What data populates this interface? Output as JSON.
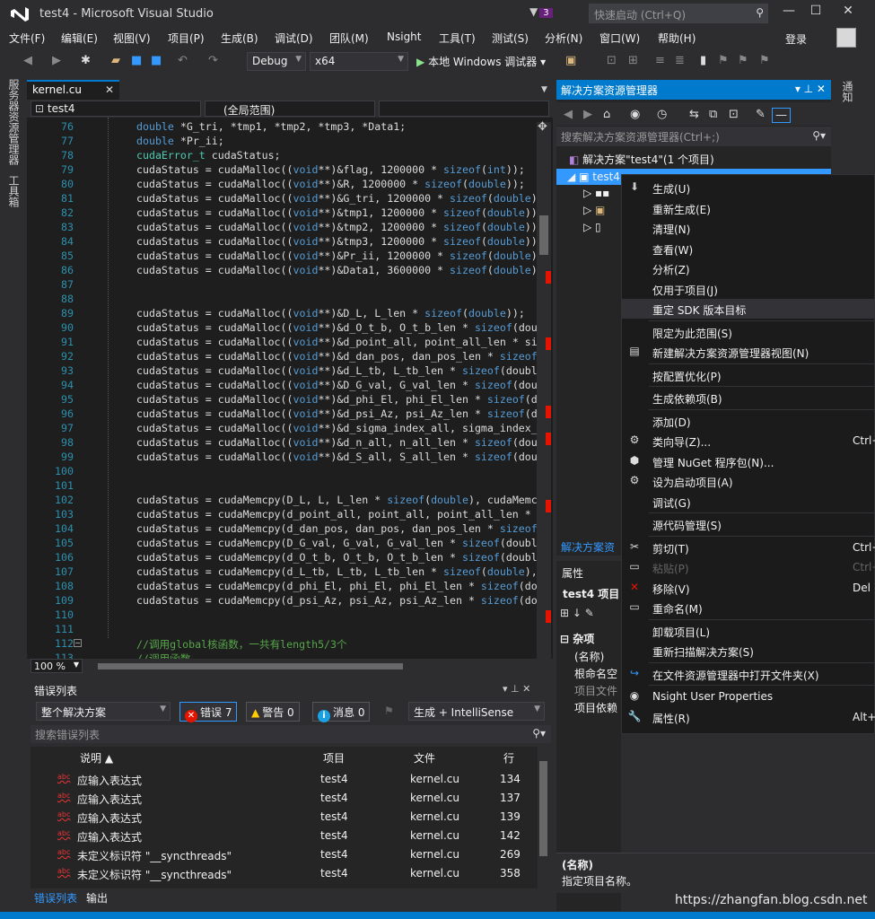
{
  "window": {
    "title": "test4 - Microsoft Visual Studio",
    "notification_count": "3",
    "quick_launch_placeholder": "快速启动 (Ctrl+Q)"
  },
  "menu": [
    "文件(F)",
    "编辑(E)",
    "视图(V)",
    "项目(P)",
    "生成(B)",
    "调试(D)",
    "团队(M)",
    "Nsight",
    "工具(T)",
    "测试(S)",
    "分析(N)",
    "窗口(W)",
    "帮助(H)"
  ],
  "login": "登录",
  "toolbar": {
    "config": "Debug",
    "platform": "x64",
    "run_label": "本地 Windows 调试器"
  },
  "left_tabs": [
    "服务器资源管理器",
    "工具箱"
  ],
  "editor": {
    "tab": "kernel.cu",
    "scope_project": "test4",
    "scope": "(全局范围)",
    "zoom": "100 %",
    "lines": [
      {
        "n": "76",
        "t": "double *G_tri, *tmp1, *tmp2, *tmp3, *Data1;"
      },
      {
        "n": "77",
        "t": "double *Pr_ii;"
      },
      {
        "n": "78",
        "t": "cudaError_t cudaStatus;"
      },
      {
        "n": "79",
        "t": "cudaStatus = cudaMalloc((void**)&flag, 1200000 * sizeof(int));"
      },
      {
        "n": "80",
        "t": "cudaStatus = cudaMalloc((void**)&R, 1200000 * sizeof(double));"
      },
      {
        "n": "81",
        "t": "cudaStatus = cudaMalloc((void**)&G_tri, 1200000 * sizeof(double));"
      },
      {
        "n": "82",
        "t": "cudaStatus = cudaMalloc((void**)&tmp1, 1200000 * sizeof(double));"
      },
      {
        "n": "83",
        "t": "cudaStatus = cudaMalloc((void**)&tmp2, 1200000 * sizeof(double));"
      },
      {
        "n": "84",
        "t": "cudaStatus = cudaMalloc((void**)&tmp3, 1200000 * sizeof(double));"
      },
      {
        "n": "85",
        "t": "cudaStatus = cudaMalloc((void**)&Pr_ii, 1200000 * sizeof(double));"
      },
      {
        "n": "86",
        "t": "cudaStatus = cudaMalloc((void**)&Data1, 3600000 * sizeof(double));"
      },
      {
        "n": "87",
        "t": ""
      },
      {
        "n": "88",
        "t": ""
      },
      {
        "n": "89",
        "t": "cudaStatus = cudaMalloc((void**)&D_L, L_len * sizeof(double));"
      },
      {
        "n": "90",
        "t": "cudaStatus = cudaMalloc((void**)&d_O_t_b, O_t_b_len * sizeof(dou"
      },
      {
        "n": "91",
        "t": "cudaStatus = cudaMalloc((void**)&d_point_all, point_all_len * si"
      },
      {
        "n": "92",
        "t": "cudaStatus = cudaMalloc((void**)&d_dan_pos, dan_pos_len * sizeof"
      },
      {
        "n": "93",
        "t": "cudaStatus = cudaMalloc((void**)&d_L_tb, L_tb_len * sizeof(doubl"
      },
      {
        "n": "94",
        "t": "cudaStatus = cudaMalloc((void**)&D_G_val, G_val_len * sizeof(dou"
      },
      {
        "n": "95",
        "t": "cudaStatus = cudaMalloc((void**)&d_phi_El, phi_El_len * sizeof(d"
      },
      {
        "n": "96",
        "t": "cudaStatus = cudaMalloc((void**)&d_psi_Az, psi_Az_len * sizeof(d"
      },
      {
        "n": "97",
        "t": "cudaStatus = cudaMalloc((void**)&d_sigma_index_all, sigma_index_"
      },
      {
        "n": "98",
        "t": "cudaStatus = cudaMalloc((void**)&d_n_all, n_all_len * sizeof(dou"
      },
      {
        "n": "99",
        "t": "cudaStatus = cudaMalloc((void**)&d_S_all, S_all_len * sizeof(dou"
      },
      {
        "n": "100",
        "t": ""
      },
      {
        "n": "101",
        "t": ""
      },
      {
        "n": "102",
        "t": "cudaStatus = cudaMemcpy(D_L, L, L_len * sizeof(double), cudaMemc"
      },
      {
        "n": "103",
        "t": "cudaStatus = cudaMemcpy(d_point_all, point_all, point_all_len *"
      },
      {
        "n": "104",
        "t": "cudaStatus = cudaMemcpy(d_dan_pos, dan_pos, dan_pos_len * sizeof"
      },
      {
        "n": "105",
        "t": "cudaStatus = cudaMemcpy(D_G_val, G_val, G_val_len * sizeof(doubl"
      },
      {
        "n": "106",
        "t": "cudaStatus = cudaMemcpy(d_O_t_b, O_t_b, O_t_b_len * sizeof(doubl"
      },
      {
        "n": "107",
        "t": "cudaStatus = cudaMemcpy(d_L_tb, L_tb, L_tb_len * sizeof(double),"
      },
      {
        "n": "108",
        "t": "cudaStatus = cudaMemcpy(d_phi_El, phi_El, phi_El_len * sizeof(do"
      },
      {
        "n": "109",
        "t": "cudaStatus = cudaMemcpy(d_psi_Az, psi_Az, psi_Az_len * sizeof(do"
      },
      {
        "n": "110",
        "t": ""
      },
      {
        "n": "111",
        "t": ""
      },
      {
        "n": "112",
        "t": "//调用global核函数，一共有length5/3个"
      },
      {
        "n": "113",
        "t": "//调用函数"
      }
    ]
  },
  "error_list": {
    "title": "错误列表",
    "scope": "整个解决方案",
    "errors_label": "错误 7",
    "warnings_label": "警告 0",
    "messages_label": "消息 0",
    "build_filter": "生成 + IntelliSense",
    "search_placeholder": "搜索错误列表",
    "columns": [
      "说明",
      "项目",
      "文件",
      "行"
    ],
    "rows": [
      {
        "desc": "应输入表达式",
        "project": "test4",
        "file": "kernel.cu",
        "line": "134"
      },
      {
        "desc": "应输入表达式",
        "project": "test4",
        "file": "kernel.cu",
        "line": "137"
      },
      {
        "desc": "应输入表达式",
        "project": "test4",
        "file": "kernel.cu",
        "line": "139"
      },
      {
        "desc": "应输入表达式",
        "project": "test4",
        "file": "kernel.cu",
        "line": "142"
      },
      {
        "desc": "未定义标识符 \"__syncthreads\"",
        "project": "test4",
        "file": "kernel.cu",
        "line": "269"
      },
      {
        "desc": "未定义标识符 \"__syncthreads\"",
        "project": "test4",
        "file": "kernel.cu",
        "line": "358"
      }
    ],
    "bottom_tabs": [
      "错误列表",
      "输出"
    ]
  },
  "solution_explorer": {
    "title": "解决方案资源管理器",
    "search_placeholder": "搜索解决方案资源管理器(Ctrl+;)",
    "solution_label": "解决方案\"test4\"(1 个项目)",
    "project_label": "test4",
    "footer_tab": "解决方案资"
  },
  "properties": {
    "title": "属性",
    "object": "test4 项目",
    "category": "杂项",
    "rows": [
      "(名称)",
      "根命名空",
      "项目文件",
      "项目依赖"
    ],
    "desc_title": "(名称)",
    "desc_text": "指定项目名称。"
  },
  "right_strip": "通知",
  "context_menu": [
    {
      "label": "生成(U)",
      "icon": "build-icon",
      "sep": false
    },
    {
      "label": "重新生成(E)",
      "icon": "",
      "sep": false
    },
    {
      "label": "清理(N)",
      "icon": "",
      "sep": false
    },
    {
      "label": "查看(W)",
      "icon": "",
      "sep": false
    },
    {
      "label": "分析(Z)",
      "icon": "",
      "sep": false
    },
    {
      "label": "仅用于项目(J)",
      "icon": "",
      "sep": false
    },
    {
      "label": "重定 SDK 版本目标",
      "icon": "",
      "sep": true,
      "highlight": true
    },
    {
      "label": "限定为此范围(S)",
      "icon": "",
      "sep": false
    },
    {
      "label": "新建解决方案资源管理器视图(N)",
      "icon": "new-view-icon",
      "sep": true
    },
    {
      "label": "按配置优化(P)",
      "icon": "",
      "sep": true
    },
    {
      "label": "生成依赖项(B)",
      "icon": "",
      "sep": true
    },
    {
      "label": "添加(D)",
      "icon": "",
      "sep": false
    },
    {
      "label": "类向导(Z)...",
      "icon": "class-wizard-icon",
      "shortcut": "Ctrl+",
      "sep": false
    },
    {
      "label": "管理 NuGet 程序包(N)...",
      "icon": "nuget-icon",
      "sep": false
    },
    {
      "label": "设为启动项目(A)",
      "icon": "gear-icon",
      "sep": false
    },
    {
      "label": "调试(G)",
      "icon": "",
      "sep": true
    },
    {
      "label": "源代码管理(S)",
      "icon": "",
      "sep": true
    },
    {
      "label": "剪切(T)",
      "icon": "cut-icon",
      "shortcut": "Ctrl+",
      "sep": false
    },
    {
      "label": "粘贴(P)",
      "icon": "paste-icon",
      "shortcut": "Ctrl+",
      "disabled": true,
      "sep": false
    },
    {
      "label": "移除(V)",
      "icon": "remove-icon",
      "shortcut": "Del",
      "sep": false
    },
    {
      "label": "重命名(M)",
      "icon": "rename-icon",
      "sep": true
    },
    {
      "label": "卸载项目(L)",
      "icon": "",
      "sep": false
    },
    {
      "label": "重新扫描解决方案(S)",
      "icon": "",
      "sep": true
    },
    {
      "label": "在文件资源管理器中打开文件夹(X)",
      "icon": "open-folder-icon",
      "sep": true
    },
    {
      "label": "Nsight User Properties",
      "icon": "nsight-icon",
      "sep": false
    },
    {
      "label": "属性(R)",
      "icon": "wrench-icon",
      "shortcut": "Alt+",
      "sep": false
    }
  ],
  "watermark": "https://zhangfan.blog.csdn.net",
  "colors": {
    "accent": "#007acc",
    "error": "#e51400",
    "keyword": "#569cd6",
    "comment": "#57a64a"
  }
}
